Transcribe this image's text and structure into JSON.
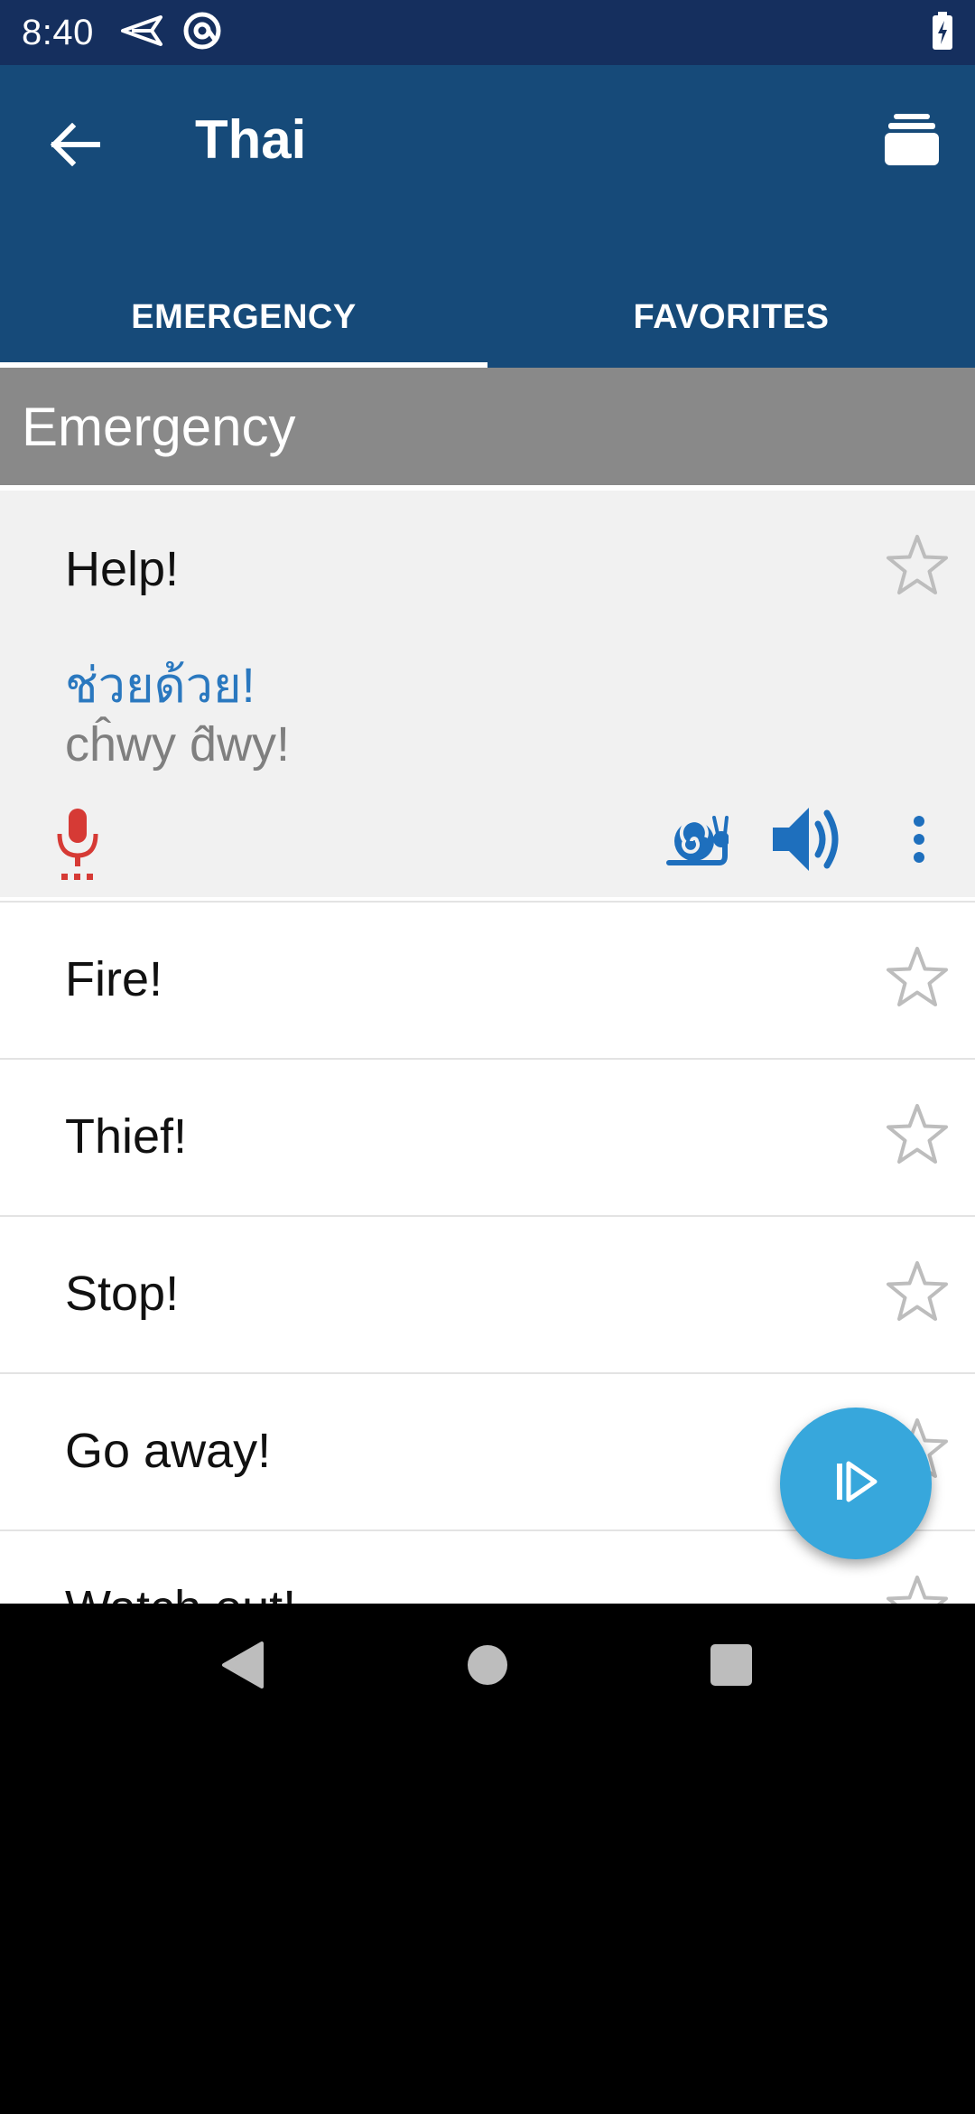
{
  "status_bar": {
    "time": "8:40",
    "icons": [
      "send-icon",
      "at-sign-icon",
      "battery-charging-icon"
    ]
  },
  "app_bar": {
    "title": "Thai",
    "back_icon": "arrow-left-icon",
    "deck_icon": "stacked-cards-icon"
  },
  "tabs": [
    {
      "label": "EMERGENCY",
      "selected": true
    },
    {
      "label": "FAVORITES",
      "selected": false
    }
  ],
  "section": {
    "title": "Emergency"
  },
  "expanded_phrase": {
    "english": "Help!",
    "thai": "ช่วยด้วย!",
    "transliteration": "cĥwy d̂wy!",
    "starred": false,
    "actions": [
      "microphone-icon",
      "snail-slow-play-icon",
      "speaker-icon",
      "more-vertical-icon"
    ]
  },
  "phrases": [
    {
      "english": "Fire!",
      "starred": false
    },
    {
      "english": "Thief!",
      "starred": false
    },
    {
      "english": "Stop!",
      "starred": false
    },
    {
      "english": "Go away!",
      "starred": false
    },
    {
      "english": "Watch out!",
      "starred": false
    }
  ],
  "fab": {
    "icon": "play-all-icon"
  },
  "nav_bar": [
    "back-triangle-icon",
    "home-circle-icon",
    "recents-square-icon"
  ],
  "colors": {
    "status_bar": "#152f5e",
    "app_bar": "#164a79",
    "section_header": "#898989",
    "expanded_bg": "#f1f1f1",
    "thai_text": "#2a78bf",
    "accent_blue": "#1e6fbd",
    "mic_red": "#d63a35",
    "fab": "#37a7dc"
  }
}
